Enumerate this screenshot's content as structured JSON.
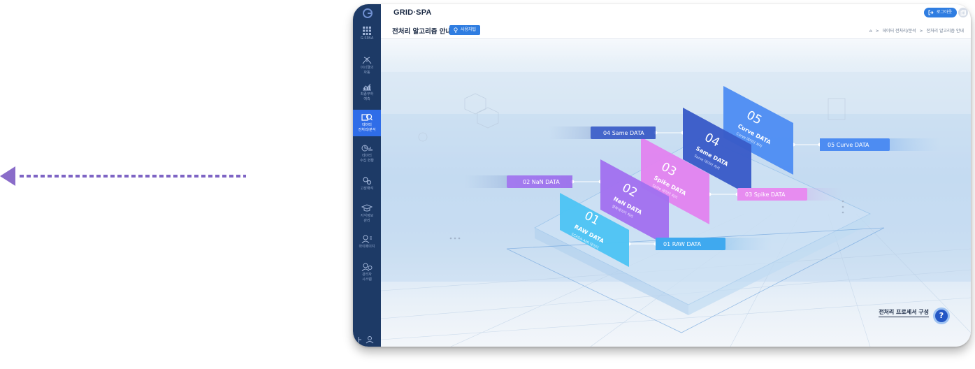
{
  "header": {
    "brand": "GRID·SPA",
    "logout_label": "로그아웃"
  },
  "subheader": {
    "title": "전처리 알고리즘 안내",
    "manual_label": "사용자팁",
    "breadcrumb": [
      "데이터 전처리/분석",
      "전처리 알고리즘 안내"
    ]
  },
  "sidebar": {
    "items": [
      {
        "label": "G-SPAA",
        "icon": "grid-icon"
      },
      {
        "label": "이너결의\n자동",
        "icon": "network-icon"
      },
      {
        "label": "최종부하\n예측",
        "icon": "chart-icon"
      },
      {
        "label": "데이터\n전처리/분석",
        "icon": "data-search-icon",
        "active": true
      },
      {
        "label": "데이터\n수집 현황",
        "icon": "pie-chart-icon"
      },
      {
        "label": "고장해석",
        "icon": "gears-icon"
      },
      {
        "label": "지식정보\n관리",
        "icon": "graduation-icon"
      },
      {
        "label": "마이페이지",
        "icon": "user-icon"
      },
      {
        "label": "관리자\n시스템",
        "icon": "admin-icon"
      }
    ]
  },
  "diagram": {
    "cards": [
      {
        "num": "01",
        "title": "RAW DATA",
        "sub": "SCADA·AMI 데이터",
        "color": "#4ec4f4"
      },
      {
        "num": "02",
        "title": "NaN DATA",
        "sub": "결측데이터 처리",
        "color": "#a272ef"
      },
      {
        "num": "03",
        "title": "Spike DATA",
        "sub": "Spike 데이터 처리",
        "color": "#e184ef"
      },
      {
        "num": "04",
        "title": "Same DATA",
        "sub": "Same 데이터 처리",
        "color": "#3a5cc8"
      },
      {
        "num": "05",
        "title": "Curve DATA",
        "sub": "Curve 데이터 처리",
        "color": "#4d8cf2"
      }
    ],
    "labels": {
      "l01": "01 RAW DATA",
      "l02": "02 NaN DATA",
      "l03": "03 Spike DATA",
      "l04": "04 Same DATA",
      "l05": "05 Curve DATA"
    }
  },
  "help": {
    "label": "전처리 프로세서 구성",
    "button": "?"
  },
  "colors": {
    "sidebar": "#1d3a66",
    "accent": "#2f7de1",
    "arrow": "#8a6cc9"
  }
}
